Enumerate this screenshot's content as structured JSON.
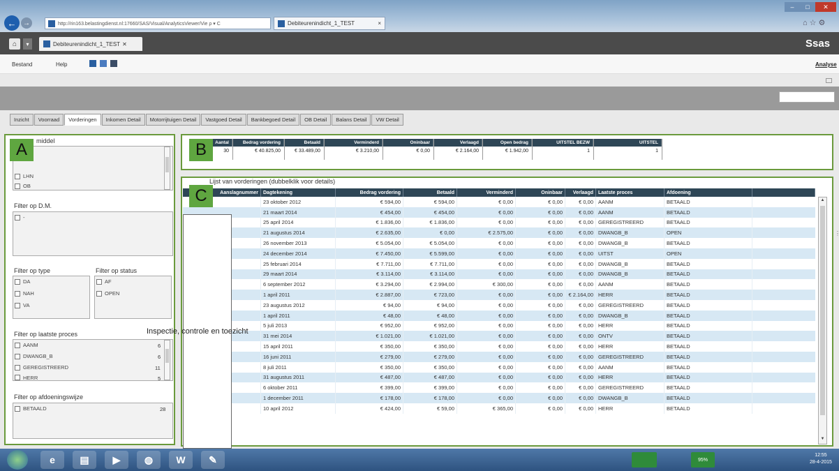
{
  "browser": {
    "url": "http://rin163.belastingdienst.nl:17660/SAS/Visual/AnalyticsViewer/Vie ρ ▾ C",
    "tab_label": "Debiteurenindicht_1_TEST",
    "tab_close": "×"
  },
  "app": {
    "doc_tab_label": "Debiteurenindicht_1_TEST",
    "logo": "Ssas",
    "menu": [
      "Bestand",
      "Help"
    ],
    "analyse_link": "Analyse"
  },
  "tabs": [
    "Inzicht",
    "Voorraad",
    "Vorderingen",
    "Inkomen Detail",
    "Motorrijtuigen Detail",
    "Vastgoed Detail",
    "Bankbegoed Detail",
    "OB Detail",
    "Balans Detail",
    "VW Detail"
  ],
  "active_tab": "Vorderingen",
  "markers": {
    "a": "A",
    "b": "B",
    "c": "C"
  },
  "filters": {
    "middel_title": "middel",
    "middel_items": [
      "LHN",
      "OB"
    ],
    "dm_title": "Filter op D.M.",
    "dm_items": [
      "-"
    ],
    "type_title": "Filter op type",
    "type_items": [
      "DA",
      "NAH",
      "VA"
    ],
    "status_title": "Filter op status",
    "status_items": [
      "AF",
      "OPEN"
    ],
    "proces_title": "Filter op laatste proces",
    "proces_items": [
      {
        "label": "AANM",
        "count": "6"
      },
      {
        "label": "DWANGB_B",
        "count": "6"
      },
      {
        "label": "GEREGISTREERD",
        "count": "11"
      },
      {
        "label": "HERR",
        "count": "5"
      }
    ],
    "afdoening_title": "Filter op afdoeningswijze",
    "afdoening_items": [
      {
        "label": "BETAALD",
        "count": "28"
      }
    ]
  },
  "summary": {
    "headers": [
      "Aantal",
      "Bedrag vordering",
      "Betaald",
      "Verminderd",
      "Oninbaar",
      "Verlaagd",
      "Open bedrag",
      "UITSTEL BEZW",
      "UITSTEL"
    ],
    "values": [
      "30",
      "€ 40.825,00",
      "€ 33.489,00",
      "€ 3.210,00",
      "€ 0,00",
      "€ 2.164,00",
      "€ 1.942,00",
      "1",
      "1"
    ]
  },
  "detail": {
    "title": "Lijst van vorderingen (dubbelklik voor details)",
    "headers": [
      "Aanslagnummer",
      "Dagtekening",
      "Bedrag vordering",
      "Betaald",
      "Verminderd",
      "Oninbaar",
      "Verlaagd",
      "Laatste proces",
      "Afdoening"
    ],
    "rows": [
      [
        "",
        "23 oktober 2012",
        "€ 594,00",
        "€ 594,00",
        "€ 0,00",
        "€ 0,00",
        "€ 0,00",
        "AANM",
        "BETAALD"
      ],
      [
        "",
        "21 maart 2014",
        "€ 454,00",
        "€ 454,00",
        "€ 0,00",
        "€ 0,00",
        "€ 0,00",
        "AANM",
        "BETAALD"
      ],
      [
        "",
        "25 april 2014",
        "€ 1.836,00",
        "€ 1.836,00",
        "€ 0,00",
        "€ 0,00",
        "€ 0,00",
        "GEREGISTREERD",
        "BETAALD"
      ],
      [
        "",
        "21 augustus 2014",
        "€ 2.635,00",
        "€ 0,00",
        "€ 2.575,00",
        "€ 0,00",
        "€ 0,00",
        "DWANGB_B",
        "OPEN"
      ],
      [
        "",
        "26 november 2013",
        "€ 5.054,00",
        "€ 5.054,00",
        "€ 0,00",
        "€ 0,00",
        "€ 0,00",
        "DWANGB_B",
        "BETAALD"
      ],
      [
        "",
        "24 december 2014",
        "€ 7.450,00",
        "€ 5.599,00",
        "€ 0,00",
        "€ 0,00",
        "€ 0,00",
        "UITST",
        "OPEN"
      ],
      [
        "",
        "25 februari 2014",
        "€ 7.711,00",
        "€ 7.711,00",
        "€ 0,00",
        "€ 0,00",
        "€ 0,00",
        "DWANGB_B",
        "BETAALD"
      ],
      [
        "",
        "29 maart 2014",
        "€ 3.114,00",
        "€ 3.114,00",
        "€ 0,00",
        "€ 0,00",
        "€ 0,00",
        "DWANGB_B",
        "BETAALD"
      ],
      [
        "",
        "6 september 2012",
        "€ 3.294,00",
        "€ 2.994,00",
        "€ 300,00",
        "€ 0,00",
        "€ 0,00",
        "AANM",
        "BETAALD"
      ],
      [
        "",
        "1 april 2011",
        "€ 2.887,00",
        "€ 723,00",
        "€ 0,00",
        "€ 0,00",
        "€ 2.164,00",
        "HERR",
        "BETAALD"
      ],
      [
        "",
        "23 augustus 2012",
        "€ 94,00",
        "€ 94,00",
        "€ 0,00",
        "€ 0,00",
        "€ 0,00",
        "GEREGISTREERD",
        "BETAALD"
      ],
      [
        "",
        "1 april 2011",
        "€ 48,00",
        "€ 48,00",
        "€ 0,00",
        "€ 0,00",
        "€ 0,00",
        "DWANGB_B",
        "BETAALD"
      ],
      [
        "",
        "5 juli 2013",
        "€ 952,00",
        "€ 952,00",
        "€ 0,00",
        "€ 0,00",
        "€ 0,00",
        "HERR",
        "BETAALD"
      ],
      [
        "",
        "31 mei 2014",
        "€ 1.021,00",
        "€ 1.021,00",
        "€ 0,00",
        "€ 0,00",
        "€ 0,00",
        "ONTV",
        "BETAALD"
      ],
      [
        "",
        "15 april 2011",
        "€ 350,00",
        "€ 350,00",
        "€ 0,00",
        "€ 0,00",
        "€ 0,00",
        "HERR",
        "BETAALD"
      ],
      [
        "",
        "16 juni 2011",
        "€ 279,00",
        "€ 279,00",
        "€ 0,00",
        "€ 0,00",
        "€ 0,00",
        "GEREGISTREERD",
        "BETAALD"
      ],
      [
        "",
        "8 juli 2011",
        "€ 350,00",
        "€ 350,00",
        "€ 0,00",
        "€ 0,00",
        "€ 0,00",
        "AANM",
        "BETAALD"
      ],
      [
        "",
        "31 augustus 2011",
        "€ 487,00",
        "€ 487,00",
        "€ 0,00",
        "€ 0,00",
        "€ 0,00",
        "HERR",
        "BETAALD"
      ],
      [
        "",
        "6 oktober 2011",
        "€ 399,00",
        "€ 399,00",
        "€ 0,00",
        "€ 0,00",
        "€ 0,00",
        "GEREGISTREERD",
        "BETAALD"
      ],
      [
        "",
        "1 december 2011",
        "€ 178,00",
        "€ 178,00",
        "€ 0,00",
        "€ 0,00",
        "€ 0,00",
        "DWANGB_B",
        "BETAALD"
      ],
      [
        "",
        "10 april 2012",
        "€ 424,00",
        "€ 59,00",
        "€ 365,00",
        "€ 0,00",
        "€ 0,00",
        "HERR",
        "BETAALD"
      ]
    ]
  },
  "overlay_text": "Inspectie, controle en toezicht",
  "taskbar": {
    "word": "W",
    "tray_badge": "95%",
    "time": "12:55",
    "date": "28-4-2015"
  },
  "colors": {
    "header_bg": "#2e4656",
    "row_alt": "#d7e8f4",
    "marker": "#5fa640",
    "panel_border": "#6a9a3c"
  }
}
